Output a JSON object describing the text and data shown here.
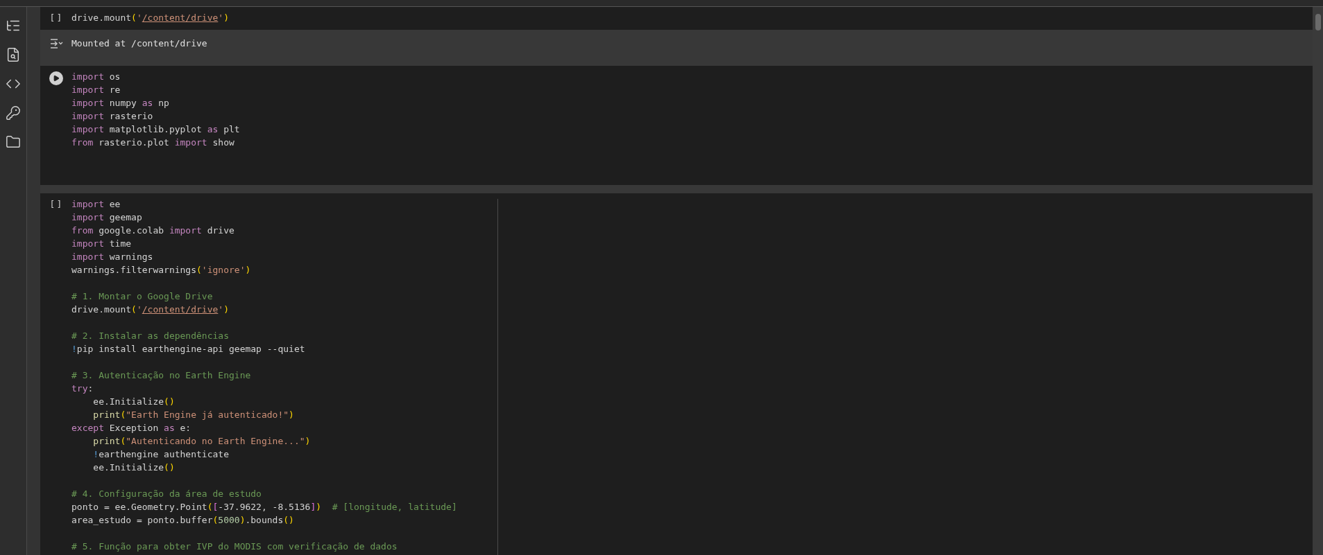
{
  "sidebar": {
    "items": [
      {
        "kind": "toc"
      },
      {
        "kind": "find"
      },
      {
        "kind": "code"
      },
      {
        "kind": "secrets"
      },
      {
        "kind": "files"
      }
    ]
  },
  "cells": [
    {
      "prompt": {
        "kind": "brackets",
        "text": "[ ]"
      },
      "lines": [
        {
          "kind": "code",
          "tokens": [
            {
              "kind": "plain",
              "text": "drive.mount"
            },
            {
              "kind": "paren",
              "text": "("
            },
            {
              "kind": "str",
              "text": "'"
            },
            {
              "kind": "link",
              "text": "/content/drive"
            },
            {
              "kind": "str",
              "text": "'"
            },
            {
              "kind": "paren",
              "text": ")"
            }
          ]
        }
      ],
      "output": {
        "text": "Mounted at /content/drive"
      },
      "ruler": false
    },
    {
      "prompt": {
        "kind": "run"
      },
      "lines": [
        {
          "kind": "code",
          "tokens": [
            {
              "kind": "kw",
              "text": "import"
            },
            {
              "kind": "plain",
              "text": " os"
            }
          ]
        },
        {
          "kind": "code",
          "tokens": [
            {
              "kind": "kw",
              "text": "import"
            },
            {
              "kind": "plain",
              "text": " re"
            }
          ]
        },
        {
          "kind": "code",
          "tokens": [
            {
              "kind": "kw",
              "text": "import"
            },
            {
              "kind": "plain",
              "text": " numpy "
            },
            {
              "kind": "kw",
              "text": "as"
            },
            {
              "kind": "plain",
              "text": " np"
            }
          ]
        },
        {
          "kind": "code",
          "tokens": [
            {
              "kind": "kw",
              "text": "import"
            },
            {
              "kind": "plain",
              "text": " rasterio"
            }
          ]
        },
        {
          "kind": "code",
          "tokens": [
            {
              "kind": "kw",
              "text": "import"
            },
            {
              "kind": "plain",
              "text": " matplotlib.pyplot "
            },
            {
              "kind": "kw",
              "text": "as"
            },
            {
              "kind": "plain",
              "text": " plt"
            }
          ]
        },
        {
          "kind": "code",
          "tokens": [
            {
              "kind": "kw",
              "text": "from"
            },
            {
              "kind": "plain",
              "text": " rasterio.plot "
            },
            {
              "kind": "kw",
              "text": "import"
            },
            {
              "kind": "plain",
              "text": " show"
            }
          ]
        }
      ],
      "ruler": false
    },
    {
      "prompt": {
        "kind": "brackets",
        "text": "[ ]"
      },
      "lines": [
        {
          "kind": "code",
          "tokens": [
            {
              "kind": "kw",
              "text": "import"
            },
            {
              "kind": "plain",
              "text": " ee"
            }
          ]
        },
        {
          "kind": "code",
          "tokens": [
            {
              "kind": "kw",
              "text": "import"
            },
            {
              "kind": "plain",
              "text": " geemap"
            }
          ]
        },
        {
          "kind": "code",
          "tokens": [
            {
              "kind": "kw",
              "text": "from"
            },
            {
              "kind": "plain",
              "text": " google.colab "
            },
            {
              "kind": "kw",
              "text": "import"
            },
            {
              "kind": "plain",
              "text": " drive"
            }
          ]
        },
        {
          "kind": "code",
          "tokens": [
            {
              "kind": "kw",
              "text": "import"
            },
            {
              "kind": "plain",
              "text": " time"
            }
          ]
        },
        {
          "kind": "code",
          "tokens": [
            {
              "kind": "kw",
              "text": "import"
            },
            {
              "kind": "plain",
              "text": " warnings"
            }
          ]
        },
        {
          "kind": "code",
          "tokens": [
            {
              "kind": "plain",
              "text": "warnings.filterwarnings"
            },
            {
              "kind": "paren",
              "text": "("
            },
            {
              "kind": "str",
              "text": "'ignore'"
            },
            {
              "kind": "paren",
              "text": ")"
            }
          ]
        },
        {
          "kind": "blank"
        },
        {
          "kind": "code",
          "tokens": [
            {
              "kind": "comment",
              "text": "# 1. Montar o Google Drive"
            }
          ]
        },
        {
          "kind": "code",
          "tokens": [
            {
              "kind": "plain",
              "text": "drive.mount"
            },
            {
              "kind": "paren",
              "text": "("
            },
            {
              "kind": "str",
              "text": "'"
            },
            {
              "kind": "link",
              "text": "/content/drive"
            },
            {
              "kind": "str",
              "text": "'"
            },
            {
              "kind": "paren",
              "text": ")"
            }
          ]
        },
        {
          "kind": "blank"
        },
        {
          "kind": "code",
          "tokens": [
            {
              "kind": "comment",
              "text": "# 2. Instalar as dependências"
            }
          ]
        },
        {
          "kind": "code",
          "tokens": [
            {
              "kind": "bang",
              "text": "!"
            },
            {
              "kind": "plain",
              "text": "pip install earthengine-api geemap --quiet"
            }
          ]
        },
        {
          "kind": "blank"
        },
        {
          "kind": "code",
          "tokens": [
            {
              "kind": "comment",
              "text": "# 3. Autenticação no Earth Engine"
            }
          ]
        },
        {
          "kind": "code",
          "tokens": [
            {
              "kind": "kw",
              "text": "try"
            },
            {
              "kind": "plain",
              "text": ":"
            }
          ]
        },
        {
          "kind": "code",
          "tokens": [
            {
              "kind": "plain",
              "text": "    ee.Initialize"
            },
            {
              "kind": "paren",
              "text": "()"
            }
          ]
        },
        {
          "kind": "code",
          "tokens": [
            {
              "kind": "fn",
              "text": "    print"
            },
            {
              "kind": "paren",
              "text": "("
            },
            {
              "kind": "str",
              "text": "\"Earth Engine já autenticado!\""
            },
            {
              "kind": "paren",
              "text": ")"
            }
          ]
        },
        {
          "kind": "code",
          "tokens": [
            {
              "kind": "kw",
              "text": "except"
            },
            {
              "kind": "plain",
              "text": " Exception "
            },
            {
              "kind": "kw",
              "text": "as"
            },
            {
              "kind": "plain",
              "text": " e:"
            }
          ]
        },
        {
          "kind": "code",
          "tokens": [
            {
              "kind": "fn",
              "text": "    print"
            },
            {
              "kind": "paren",
              "text": "("
            },
            {
              "kind": "str",
              "text": "\"Autenticando no Earth Engine...\""
            },
            {
              "kind": "paren",
              "text": ")"
            }
          ]
        },
        {
          "kind": "code",
          "tokens": [
            {
              "kind": "bang",
              "text": "    !"
            },
            {
              "kind": "plain",
              "text": "earthengine authenticate"
            }
          ]
        },
        {
          "kind": "code",
          "tokens": [
            {
              "kind": "plain",
              "text": "    ee.Initialize"
            },
            {
              "kind": "paren",
              "text": "()"
            }
          ]
        },
        {
          "kind": "blank"
        },
        {
          "kind": "code",
          "tokens": [
            {
              "kind": "comment",
              "text": "# 4. Configuração da área de estudo"
            }
          ]
        },
        {
          "kind": "code",
          "tokens": [
            {
              "kind": "plain",
              "text": "ponto = ee.Geometry.Point"
            },
            {
              "kind": "paren",
              "text": "("
            },
            {
              "kind": "bracket",
              "text": "["
            },
            {
              "kind": "plain",
              "text": "-37.9622, -8.5136"
            },
            {
              "kind": "bracket",
              "text": "]"
            },
            {
              "kind": "paren",
              "text": ")"
            },
            {
              "kind": "comment",
              "text": "  # [longitude, latitude]"
            }
          ]
        },
        {
          "kind": "code",
          "tokens": [
            {
              "kind": "plain",
              "text": "area_estudo = ponto.buffer"
            },
            {
              "kind": "paren",
              "text": "("
            },
            {
              "kind": "num",
              "text": "5000"
            },
            {
              "kind": "paren",
              "text": ")"
            },
            {
              "kind": "plain",
              "text": ".bounds"
            },
            {
              "kind": "paren",
              "text": "()"
            }
          ]
        },
        {
          "kind": "blank"
        },
        {
          "kind": "code",
          "tokens": [
            {
              "kind": "comment",
              "text": "# 5. Função para obter IVP do MODIS com verificação de dados"
            }
          ]
        }
      ],
      "ruler": true
    }
  ]
}
